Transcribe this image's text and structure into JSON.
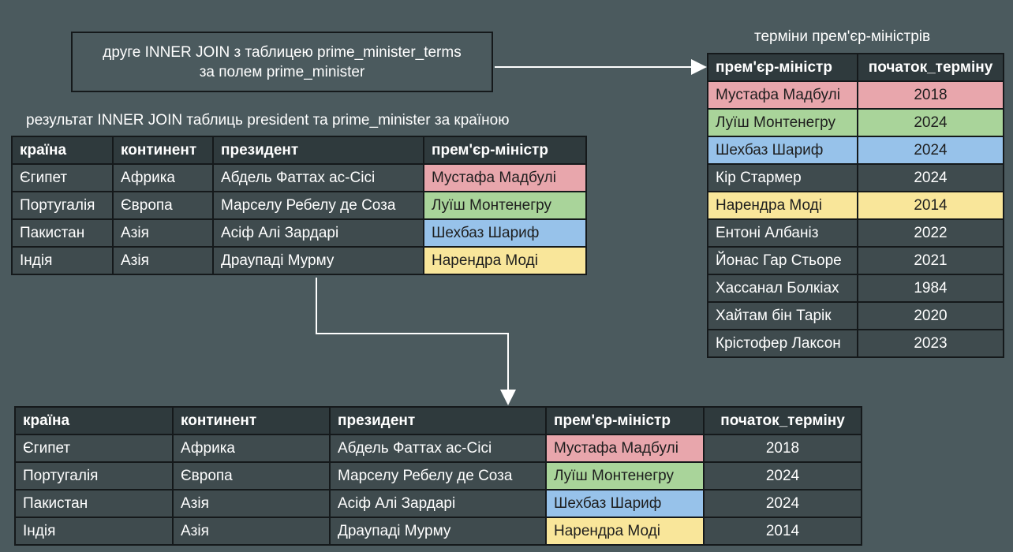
{
  "note": {
    "line1": "друге INNER JOIN з таблицею prime_minister_terms",
    "line2": "за полем prime_minister"
  },
  "left_caption": "результат INNER JOIN таблиць president та prime_minister за країною",
  "right_caption": "терміни прем'єр-міністрів",
  "highlight_colors": {
    "pink": "#e8a6ac",
    "green": "#a9d49a",
    "blue": "#97c2ea",
    "yellow": "#f9e69a"
  },
  "join1": {
    "headers": [
      "країна",
      "континент",
      "президент",
      "прем'єр-міністр"
    ],
    "rows": [
      {
        "cells": [
          "Єгипет",
          "Африка",
          "Абдель Фаттах ас-Сісі",
          "Мустафа Мадбулі"
        ],
        "color": "pink"
      },
      {
        "cells": [
          "Португалія",
          "Європа",
          "Марселу Ребелу де Соза",
          "Луїш Монтенегру"
        ],
        "color": "green"
      },
      {
        "cells": [
          "Пакистан",
          "Азія",
          "Асіф Алі Зардарі",
          "Шехбаз Шариф"
        ],
        "color": "blue"
      },
      {
        "cells": [
          "Індія",
          "Азія",
          "Драупаді Мурму",
          "Нарендра Моді"
        ],
        "color": "yellow"
      }
    ]
  },
  "terms": {
    "headers": [
      "прем'єр-міністр",
      "початок_терміну"
    ],
    "rows": [
      {
        "cells": [
          "Мустафа Мадбулі",
          "2018"
        ],
        "color": "pink"
      },
      {
        "cells": [
          "Луїш Монтенегру",
          "2024"
        ],
        "color": "green"
      },
      {
        "cells": [
          "Шехбаз Шариф",
          "2024"
        ],
        "color": "blue"
      },
      {
        "cells": [
          "Кір Стармер",
          "2024"
        ],
        "color": ""
      },
      {
        "cells": [
          "Нарендра Моді",
          "2014"
        ],
        "color": "yellow"
      },
      {
        "cells": [
          "Ентоні Албаніз",
          "2022"
        ],
        "color": ""
      },
      {
        "cells": [
          "Йонас Гар Стьоре",
          "2021"
        ],
        "color": ""
      },
      {
        "cells": [
          "Хассанал Болкіах",
          "1984"
        ],
        "color": ""
      },
      {
        "cells": [
          "Хайтам бін Тарік",
          "2020"
        ],
        "color": ""
      },
      {
        "cells": [
          "Крістофер Лаксон",
          "2023"
        ],
        "color": ""
      }
    ]
  },
  "result": {
    "headers": [
      "країна",
      "континент",
      "президент",
      "прем'єр-міністр",
      "початок_терміну"
    ],
    "rows": [
      {
        "cells": [
          "Єгипет",
          "Африка",
          "Абдель Фаттах ас-Сісі",
          "Мустафа Мадбулі",
          "2018"
        ],
        "color": "pink"
      },
      {
        "cells": [
          "Португалія",
          "Європа",
          "Марселу Ребелу де Соза",
          "Луїш Монтенегру",
          "2024"
        ],
        "color": "green"
      },
      {
        "cells": [
          "Пакистан",
          "Азія",
          "Асіф Алі Зардарі",
          "Шехбаз Шариф",
          "2024"
        ],
        "color": "blue"
      },
      {
        "cells": [
          "Індія",
          "Азія",
          "Драупаді Мурму",
          "Нарендра Моді",
          "2014"
        ],
        "color": "yellow"
      }
    ]
  }
}
